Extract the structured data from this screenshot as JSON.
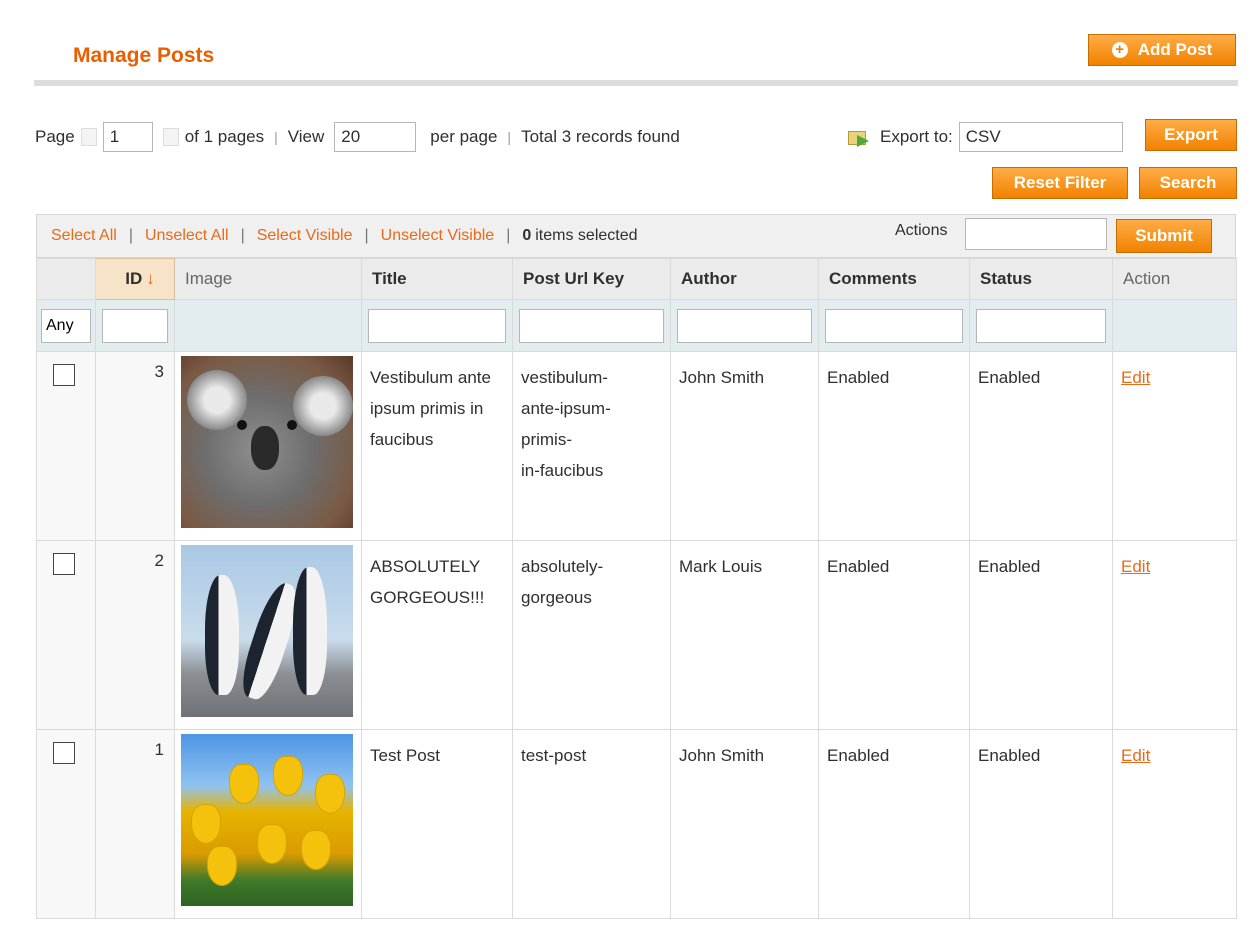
{
  "header": {
    "title": "Manage Posts",
    "add_button": "Add Post"
  },
  "pager": {
    "page_label": "Page",
    "page_value": "1",
    "of_pages": "of 1 pages",
    "view_label": "View",
    "per_page_value": "20",
    "per_page_label": "per page",
    "total": "Total 3 records found",
    "export_label": "Export to:",
    "export_value": "CSV",
    "export_button": "Export",
    "reset_button": "Reset Filter",
    "search_button": "Search"
  },
  "massaction": {
    "select_all": "Select All",
    "unselect_all": "Unselect All",
    "select_visible": "Select Visible",
    "unselect_visible": "Unselect Visible",
    "selected_count": "0",
    "selected_label": "items selected",
    "actions_label": "Actions",
    "submit_button": "Submit"
  },
  "columns": {
    "id": "ID",
    "image": "Image",
    "title": "Title",
    "url_key": "Post Url Key",
    "author": "Author",
    "comments": "Comments",
    "status": "Status",
    "action": "Action"
  },
  "filter": {
    "any": "Any"
  },
  "rows": [
    {
      "id": "3",
      "image": "koala",
      "title": "Vestibulum ante ipsum primis in faucibus",
      "url_key": "vestibulum-ante-ipsum-primis-in-faucibus",
      "author": "John Smith",
      "comments": "Enabled",
      "status": "Enabled",
      "action": "Edit"
    },
    {
      "id": "2",
      "image": "penguins",
      "title": "ABSOLUTELY GORGEOUS!!!",
      "url_key": "absolutely-gorgeous",
      "author": "Mark Louis",
      "comments": "Enabled",
      "status": "Enabled",
      "action": "Edit"
    },
    {
      "id": "1",
      "image": "tulips",
      "title": "Test Post",
      "url_key": "test-post",
      "author": "John Smith",
      "comments": "Enabled",
      "status": "Enabled",
      "action": "Edit"
    }
  ],
  "colors": {
    "accent": "#eb5e00",
    "button": "#f18200",
    "filter_row": "#e3ecef"
  }
}
